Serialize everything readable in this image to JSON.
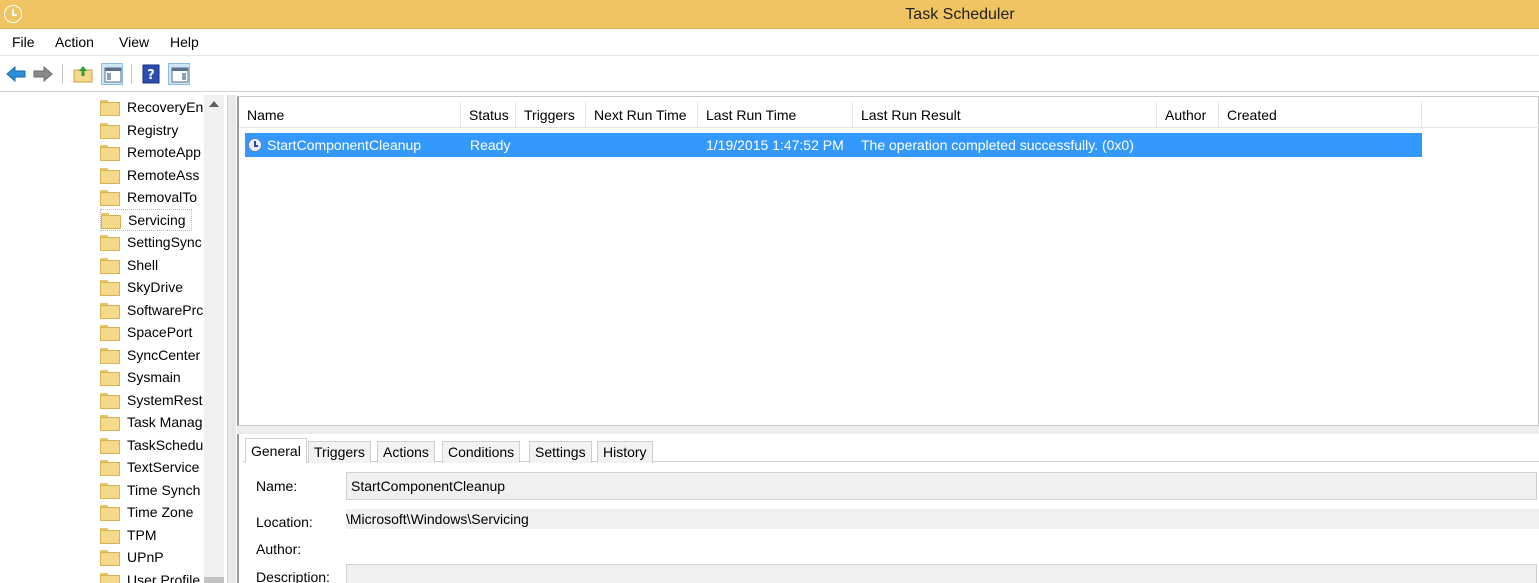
{
  "window": {
    "title": "Task Scheduler"
  },
  "menu": [
    "File",
    "Action",
    "View",
    "Help"
  ],
  "toolbar": {
    "icons": [
      "back-arrow-icon",
      "forward-arrow-icon",
      "up-folder-icon",
      "show-hide-console-tree-icon",
      "help-icon",
      "show-hide-action-pane-icon"
    ]
  },
  "tree": {
    "items": [
      "RecoveryEn",
      "Registry",
      "RemoteApp",
      "RemoteAss",
      "RemovalTo",
      "Servicing",
      "SettingSync",
      "Shell",
      "SkyDrive",
      "SoftwarePrc",
      "SpacePort",
      "SyncCenter",
      "Sysmain",
      "SystemRest",
      "Task Manag",
      "TaskSchedu",
      "TextService",
      "Time Synch",
      "Time Zone",
      "TPM",
      "UPnP",
      "User Profile"
    ],
    "selected": "Servicing"
  },
  "task_list": {
    "columns": [
      "Name",
      "Status",
      "Triggers",
      "Next Run Time",
      "Last Run Time",
      "Last Run Result",
      "Author",
      "Created"
    ],
    "rows": [
      {
        "name": "StartComponentCleanup",
        "status": "Ready",
        "triggers": "",
        "next_run_time": "",
        "last_run_time": "1/19/2015 1:47:52 PM",
        "last_run_result": "The operation completed successfully. (0x0)",
        "author": "",
        "created": ""
      }
    ]
  },
  "details": {
    "tabs": [
      "General",
      "Triggers",
      "Actions",
      "Conditions",
      "Settings",
      "History"
    ],
    "active_tab": "General",
    "name_label": "Name:",
    "name_value": "StartComponentCleanup",
    "location_label": "Location:",
    "location_value": "\\Microsoft\\Windows\\Servicing",
    "author_label": "Author:",
    "author_value": "",
    "description_label": "Description:",
    "description_value": ""
  },
  "colors": {
    "titlebar": "#f0c462",
    "selection": "#3399ff"
  }
}
